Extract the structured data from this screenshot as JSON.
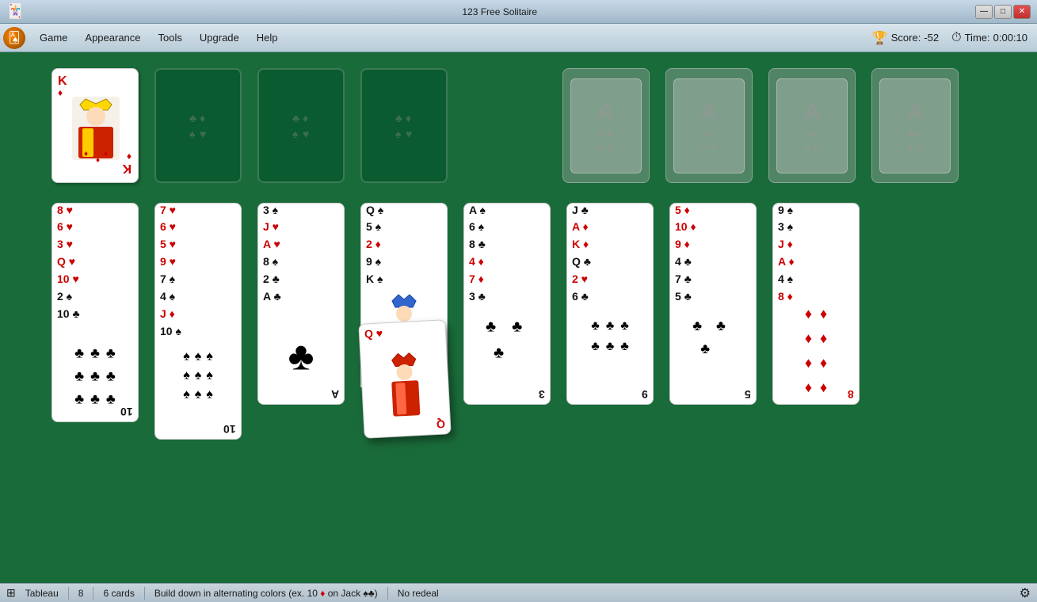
{
  "window": {
    "title": "123 Free Solitaire",
    "controls": {
      "minimize": "—",
      "maximize": "□",
      "close": "✕"
    }
  },
  "menubar": {
    "items": [
      "Game",
      "Appearance",
      "Tools",
      "Upgrade",
      "Help"
    ]
  },
  "score": {
    "label": "Score:",
    "value": "-52",
    "time_label": "Time:",
    "time_value": "0:00:10"
  },
  "statusbar": {
    "type": "Tableau",
    "columns": "8",
    "cards": "6 cards",
    "rule": "Build down in alternating colors (ex. 10",
    "on": "on Jack ♠♣)",
    "redeal": "No redeal"
  }
}
